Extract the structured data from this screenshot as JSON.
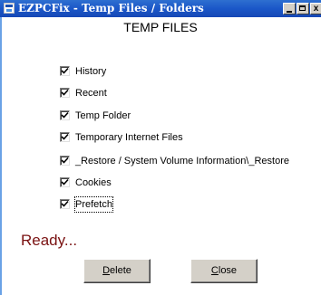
{
  "window": {
    "title": "EZPCFix - Temp Files / Folders",
    "title_close_glyph": "x"
  },
  "main": {
    "heading": "TEMP FILES",
    "options": [
      {
        "label": "History",
        "checked": true
      },
      {
        "label": "Recent",
        "checked": true
      },
      {
        "label": "Temp Folder",
        "checked": true
      },
      {
        "label": "Temporary Internet Files",
        "checked": true
      },
      {
        "label": "_Restore / System Volume Information\\_Restore",
        "checked": true
      },
      {
        "label": "Cookies",
        "checked": true
      },
      {
        "label": "Prefetch",
        "checked": true
      }
    ],
    "status": "Ready..."
  },
  "buttons": {
    "delete_accel": "D",
    "delete_rest": "elete",
    "close_accel": "C",
    "close_rest": "lose"
  },
  "colors": {
    "titlebar": "#1b57c8",
    "status_text": "#7a1212",
    "button_face": "#d4d0c8"
  },
  "icons": {
    "app": "app-window-icon",
    "minimize": "minimize-icon",
    "maximize": "maximize-icon",
    "check": "check-icon"
  }
}
